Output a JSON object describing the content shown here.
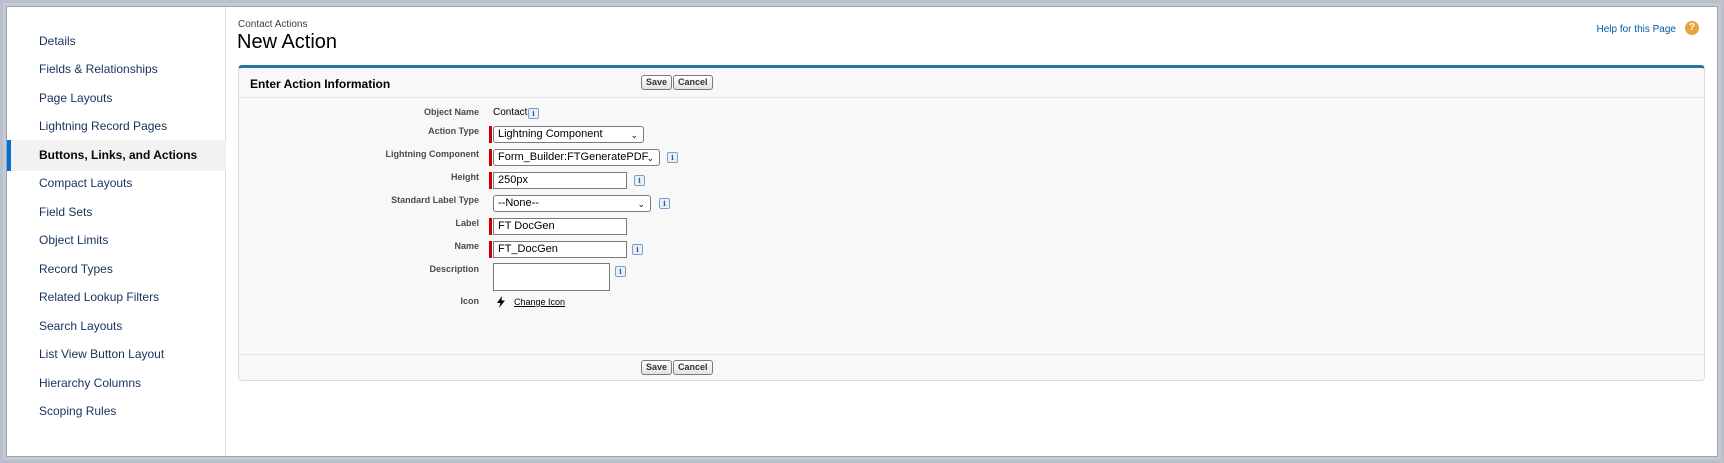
{
  "sidebar": {
    "items": [
      {
        "label": "Details"
      },
      {
        "label": "Fields & Relationships"
      },
      {
        "label": "Page Layouts"
      },
      {
        "label": "Lightning Record Pages"
      },
      {
        "label": "Buttons, Links, and Actions"
      },
      {
        "label": "Compact Layouts"
      },
      {
        "label": "Field Sets"
      },
      {
        "label": "Object Limits"
      },
      {
        "label": "Record Types"
      },
      {
        "label": "Related Lookup Filters"
      },
      {
        "label": "Search Layouts"
      },
      {
        "label": "List View Button Layout"
      },
      {
        "label": "Hierarchy Columns"
      },
      {
        "label": "Scoping Rules"
      }
    ],
    "active": "Buttons, Links, and Actions"
  },
  "header": {
    "breadcrumb": "Contact Actions",
    "title": "New Action",
    "help_link": "Help for this Page",
    "help_icon": "?"
  },
  "panel": {
    "title": "Enter Action Information",
    "save_label": "Save",
    "cancel_label": "Cancel"
  },
  "form": {
    "object_name": {
      "label": "Object Name",
      "value": "Contact"
    },
    "action_type": {
      "label": "Action Type",
      "value": "Lightning Component"
    },
    "lightning_component": {
      "label": "Lightning Component",
      "value": "Form_Builder:FTGeneratePDF"
    },
    "height": {
      "label": "Height",
      "value": "250px"
    },
    "standard_label_type": {
      "label": "Standard Label Type",
      "value": "--None--"
    },
    "label": {
      "label": "Label",
      "value": "FT DocGen"
    },
    "name": {
      "label": "Name",
      "value": "FT_DocGen"
    },
    "description": {
      "label": "Description",
      "value": ""
    },
    "icon": {
      "label": "Icon",
      "link": "Change Icon"
    },
    "info_glyph": "i"
  },
  "colors": {
    "accent": "#0070d2",
    "required": "#cc0000",
    "panel_border": "#2a739e"
  }
}
